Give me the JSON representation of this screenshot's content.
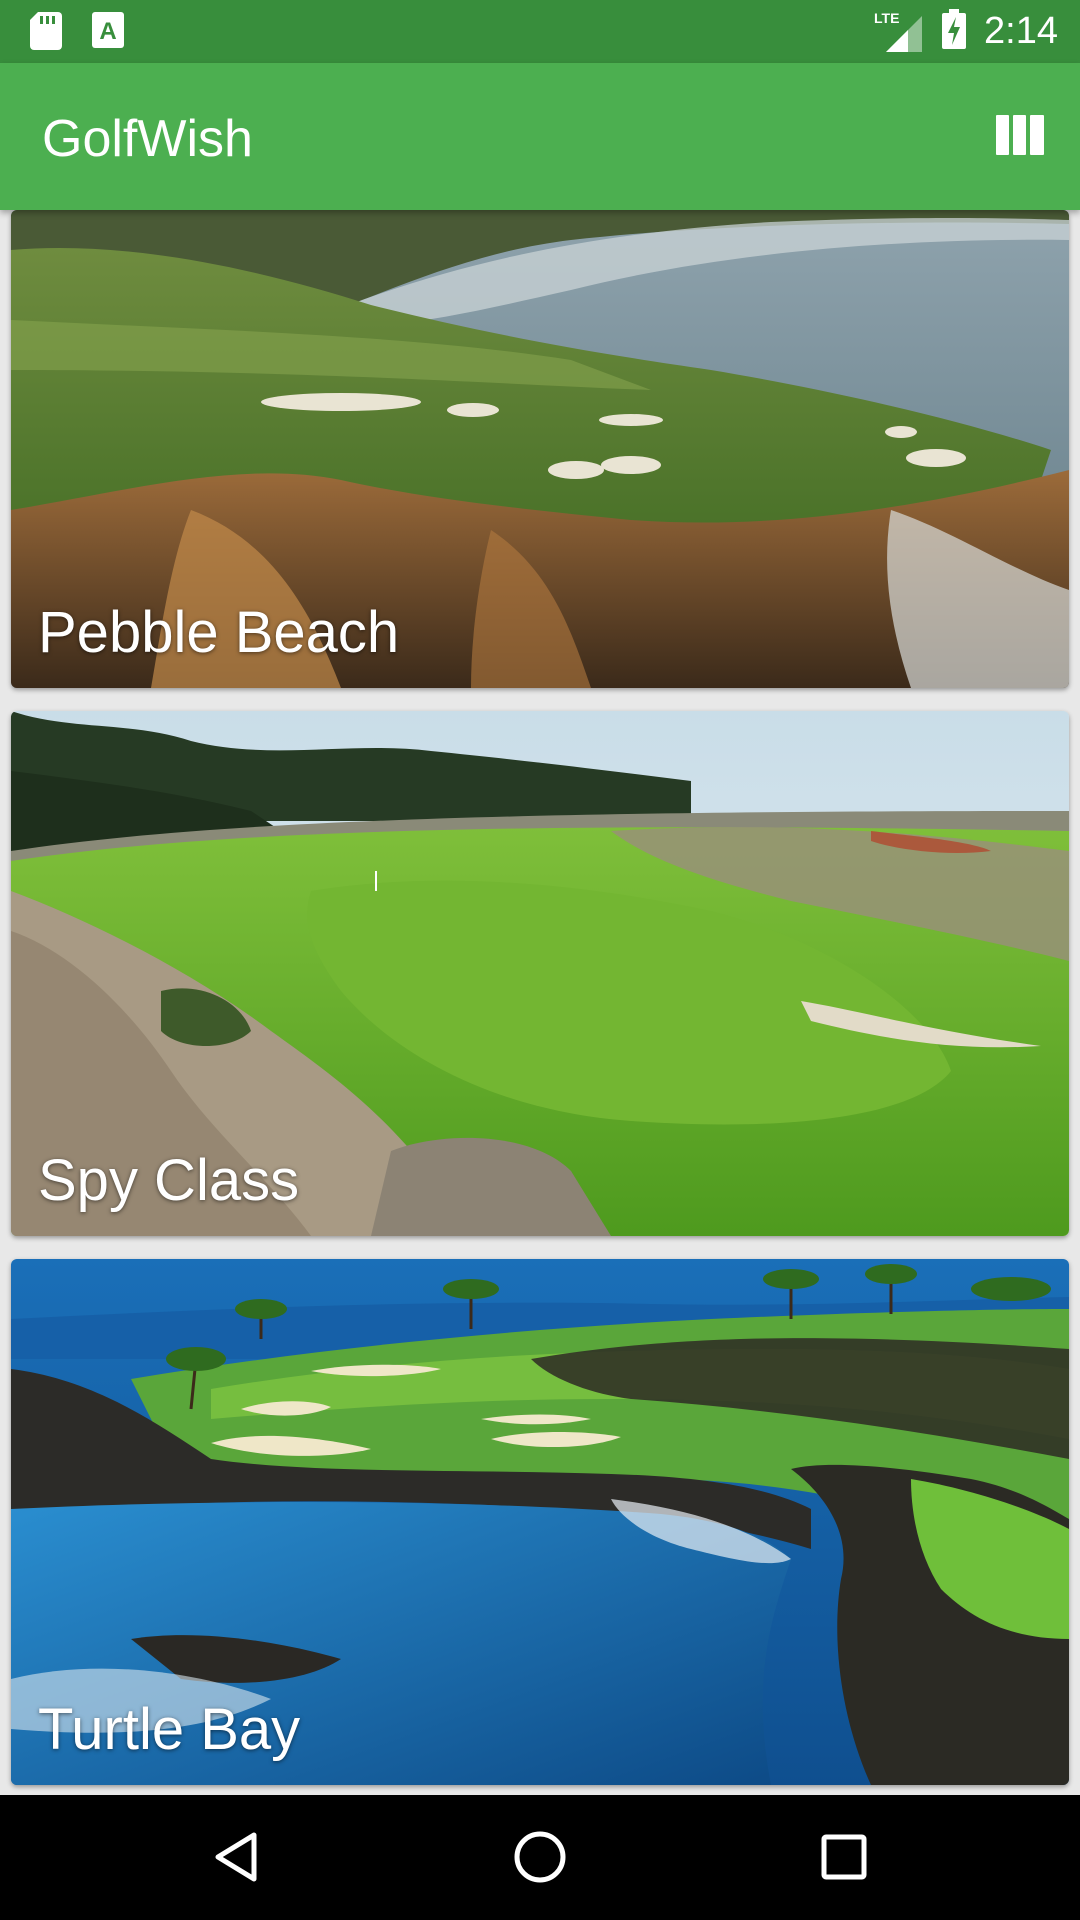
{
  "status_bar": {
    "time": "2:14",
    "network": "LTE",
    "left_icons": [
      "sd-card-icon",
      "a-notification-icon"
    ],
    "right_icons": [
      "lte-signal-icon",
      "battery-charging-icon"
    ]
  },
  "app_bar": {
    "title": "GolfWish",
    "action_icon": "view-column-icon",
    "color": "#4caf50",
    "status_color": "#388e3c"
  },
  "courses": [
    {
      "name": "Pebble Beach"
    },
    {
      "name": "Spy Class"
    },
    {
      "name": "Turtle Bay"
    }
  ],
  "nav_bar": {
    "icons": [
      "back-icon",
      "home-icon",
      "recents-icon"
    ]
  }
}
